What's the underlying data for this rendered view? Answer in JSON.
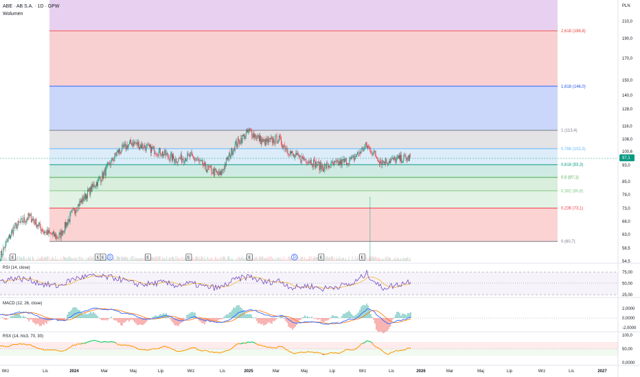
{
  "header": {
    "title": "ABE · AB S.A. · 1D · GPW",
    "volume_label": "Wolumen",
    "currency": "PLN"
  },
  "price_axis": {
    "ticks": [
      "210,0",
      "190,0",
      "170,0",
      "150,0",
      "140,0",
      "128,0",
      "116,0",
      "108,0",
      "100,6",
      "93,0",
      "85,0",
      "79,0",
      "73,0",
      "68,0",
      "63,0",
      "58,5",
      "54,5"
    ],
    "ticks_values": [
      210,
      190,
      170,
      150,
      140,
      128,
      116,
      108,
      100.6,
      93,
      85,
      79,
      73,
      68,
      63,
      58.5,
      54.5
    ],
    "current_price": "97,1",
    "current_price_value": 97.1
  },
  "fib_levels": [
    {
      "label": "2,618 (198,8)",
      "value": 198.8,
      "text_color": "#e53935",
      "line_color": "#ef5350",
      "fill": "#e8d1f0"
    },
    {
      "label": "1,618 (146,0)",
      "value": 146.0,
      "text_color": "#1e53e5",
      "line_color": "#2962ff",
      "fill": "#f9d0d2"
    },
    {
      "label": "1 (113,4)",
      "value": 113.4,
      "text_color": "#787b86",
      "line_color": "#787b86",
      "fill": "#cad7fb"
    },
    {
      "label": "0,786 (102,3)",
      "value": 102.3,
      "text_color": "#64b5f6",
      "line_color": "#64b5f6",
      "fill": "#e3e3e6"
    },
    {
      "label": "0,618 (93,3)",
      "value": 93.3,
      "text_color": "#089981",
      "line_color": "#089981",
      "fill": "#dcecf9"
    },
    {
      "label": "0,5 (87,1)",
      "value": 87.1,
      "text_color": "#4caf50",
      "line_color": "#4caf50",
      "fill": "#cfeae3"
    },
    {
      "label": "0,382 (80,8)",
      "value": 80.8,
      "text_color": "#81c784",
      "line_color": "#81c784",
      "fill": "#d9eedc"
    },
    {
      "label": "0,236 (73,1)",
      "value": 73.1,
      "text_color": "#f23645",
      "line_color": "#f23645",
      "fill": "#e2f2e4"
    },
    {
      "label": "0 (60,7)",
      "value": 60.7,
      "text_color": "#787b86",
      "line_color": "#787b86",
      "fill": "#fbd3d3"
    }
  ],
  "events": [
    {
      "label": "E",
      "kind": "earnings",
      "pos": 0.02
    },
    {
      "label": "E",
      "kind": "earnings",
      "pos": 0.153
    },
    {
      "label": "E",
      "kind": "earnings",
      "pos": 0.161
    },
    {
      "label": "D",
      "kind": "dividend",
      "pos": 0.172
    },
    {
      "label": "E",
      "kind": "earnings",
      "pos": 0.231
    },
    {
      "label": "E",
      "kind": "earnings",
      "pos": 0.295
    },
    {
      "label": "E",
      "kind": "earnings",
      "pos": 0.39
    },
    {
      "label": "D",
      "kind": "dividend",
      "pos": 0.46
    },
    {
      "label": "E",
      "kind": "earnings",
      "pos": 0.502
    },
    {
      "label": "E",
      "kind": "earnings",
      "pos": 0.566
    }
  ],
  "time_axis": [
    "Wrz",
    "Lis",
    "2024",
    "Mar",
    "Maj",
    "Lip",
    "Wrz",
    "Lis",
    "2025",
    "Mar",
    "Maj",
    "Lip",
    "Wrz",
    "Lis",
    "2026",
    "Mar",
    "Maj",
    "Lip",
    "Wrz",
    "Lis",
    "2027"
  ],
  "time_axis_bold": [
    "2024",
    "2025",
    "2026",
    "2027"
  ],
  "panels": {
    "rsi": {
      "label": "RSI (14, close)",
      "ticks": [
        "75,00",
        "50,00",
        "25,00"
      ],
      "tick_values": [
        75,
        50,
        25
      ]
    },
    "macd": {
      "label": "MACD (12, 26, close)",
      "ticks": [
        "2,0000",
        "0,0000",
        "-2,0000"
      ],
      "tick_values": [
        2,
        0,
        -2
      ]
    },
    "rsx": {
      "label": "RSX (14, hlc3, 70, 30)",
      "ticks": [
        "100,0",
        "50,00",
        "0,0000"
      ],
      "tick_values": [
        100,
        50,
        0
      ]
    }
  },
  "chart_data": [
    {
      "type": "line",
      "title": "ABE · AB S.A. · 1D · GPW",
      "ylabel": "PLN",
      "ylim": [
        54.5,
        210
      ],
      "x": [
        "2023-08",
        "2023-09",
        "2023-10",
        "2023-11",
        "2023-12",
        "2024-01",
        "2024-02",
        "2024-03",
        "2024-04",
        "2024-05",
        "2024-06",
        "2024-07",
        "2024-08",
        "2024-09",
        "2024-10",
        "2024-11",
        "2024-12",
        "2025-01",
        "2025-02",
        "2025-03",
        "2025-04",
        "2025-05",
        "2025-06",
        "2025-07",
        "2025-08",
        "2025-09",
        "2025-10",
        "2025-11",
        "2025-12"
      ],
      "series": [
        {
          "values": [
            56,
            66,
            70,
            64,
            62,
            72,
            80,
            88,
            100,
            106,
            103,
            100,
            96,
            98,
            92,
            88,
            104,
            113,
            106,
            108,
            98,
            96,
            92,
            94,
            96,
            104,
            95,
            96,
            97.1
          ]
        }
      ]
    },
    {
      "type": "line",
      "title": "RSI (14, close)",
      "ylim": [
        25,
        75
      ],
      "series": [
        {
          "values": [
            55,
            62,
            58,
            48,
            44,
            60,
            66,
            64,
            62,
            50,
            48,
            52,
            46,
            50,
            42,
            40,
            58,
            66,
            52,
            56,
            40,
            45,
            38,
            44,
            48,
            72,
            40,
            46,
            56
          ]
        }
      ]
    }
  ]
}
